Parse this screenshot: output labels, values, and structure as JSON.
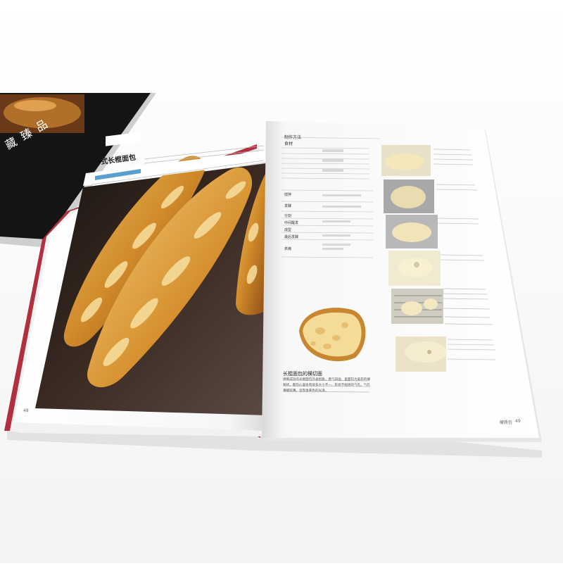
{
  "back_book": {
    "cover_text": "藏 臻 品"
  },
  "left_page": {
    "section_title": "式长棍面包",
    "page_number": "48"
  },
  "right_page": {
    "method_header": "制作方法",
    "ingredients_header": "食材",
    "steps": [
      "搅拌",
      "发酵",
      "分割",
      "中间醒发",
      "成型",
      "最后发酵",
      "烘烤"
    ],
    "photo_caption_title": "长棍面包的横切面",
    "photo_caption_text": "烘制成功的长棍面包外表松脆，香气四溢，里面较为柔软的蜂窝状，面包心里会有很多大小不一、形状不规则的气孔。气孔薄膜较薄，呈现金黄色的光泽。",
    "footer_label": "硬质包",
    "page_number": "49"
  }
}
